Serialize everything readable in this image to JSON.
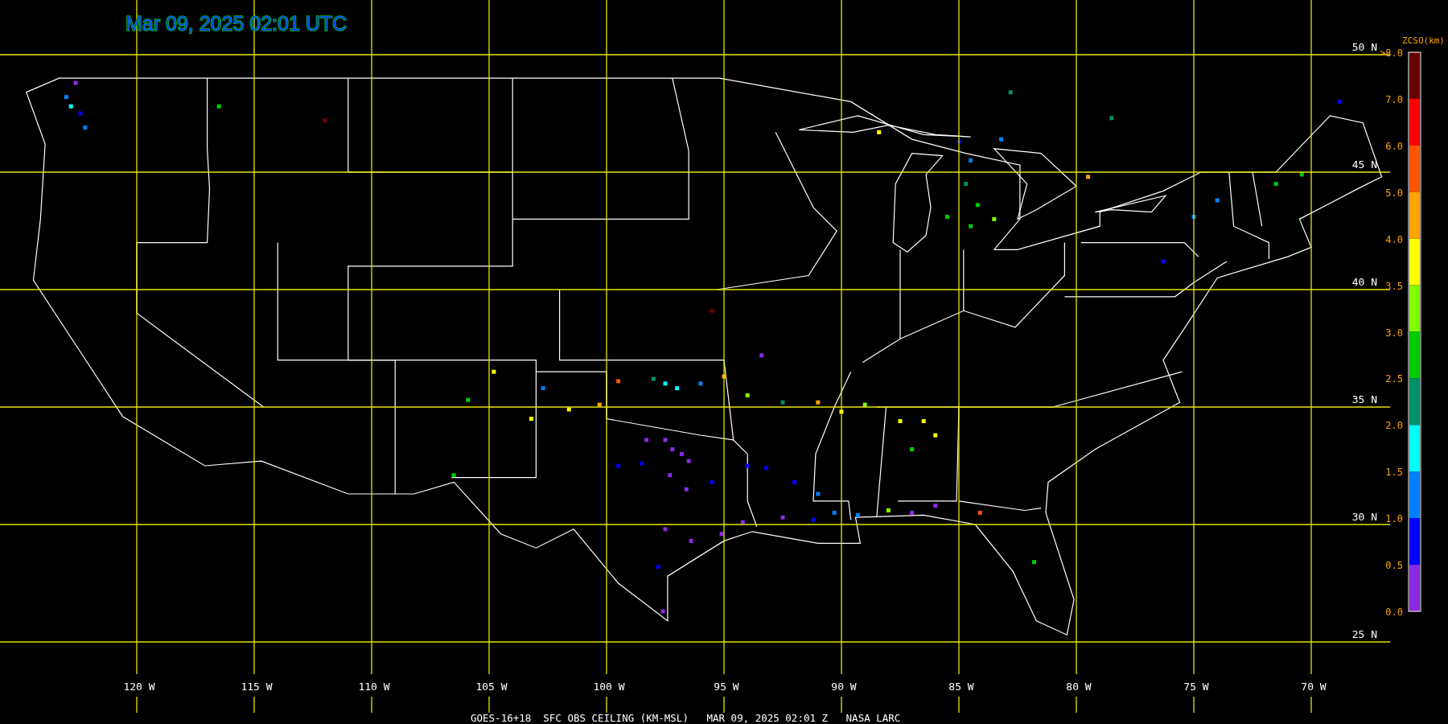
{
  "title": "Mar 09, 2025 02:01 UTC",
  "grid": {
    "latitudes": [
      {
        "label": "50 N"
      },
      {
        "label": "45 N"
      },
      {
        "label": "40 N"
      },
      {
        "label": "35 N"
      },
      {
        "label": "30 N"
      },
      {
        "label": "25 N"
      }
    ],
    "longitudes": [
      {
        "label": "120 W"
      },
      {
        "label": "115 W"
      },
      {
        "label": "110 W"
      },
      {
        "label": "105 W"
      },
      {
        "label": "100 W"
      },
      {
        "label": "95 W"
      },
      {
        "label": "90 W"
      },
      {
        "label": "85 W"
      },
      {
        "label": "80 W"
      },
      {
        "label": "75 W"
      },
      {
        "label": "70 W"
      }
    ]
  },
  "legend": {
    "title": "ZCSO(km)",
    "ticks": [
      ">8.0",
      "7.0",
      "6.0",
      "5.0",
      "4.0",
      "3.5",
      "3.0",
      "2.5",
      "2.0",
      "1.5",
      "1.0",
      "0.5",
      "0.0"
    ],
    "bands": [
      {
        "color": "#6b0000"
      },
      {
        "color": "#ff0000"
      },
      {
        "color": "#ff5500"
      },
      {
        "color": "#ffa500"
      },
      {
        "color": "#ffff00"
      },
      {
        "color": "#80ff00"
      },
      {
        "color": "#00cc00"
      },
      {
        "color": "#00906a"
      },
      {
        "color": "#00ffff"
      },
      {
        "color": "#0080ff"
      },
      {
        "color": "#0000ff"
      },
      {
        "color": "#8a2be2"
      }
    ]
  },
  "caption": "GOES-16+18  SFC OBS CEILING (KM-MSL)   MAR 09, 2025 02:01 Z   NASA LARC"
}
